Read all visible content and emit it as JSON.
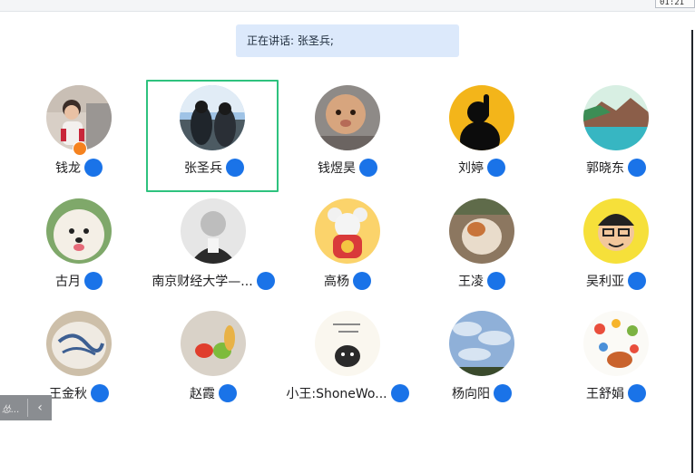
{
  "window": {
    "clock": "01:21"
  },
  "banner": {
    "text": "正在讲话: 张圣兵;"
  },
  "side_panel": {
    "label": "怂...",
    "toggle": "‹"
  },
  "participants": [
    {
      "name": "钱龙",
      "host": true,
      "active": false
    },
    {
      "name": "张圣兵",
      "host": false,
      "active": true
    },
    {
      "name": "钱煜昊",
      "host": false,
      "active": false
    },
    {
      "name": "刘婷",
      "host": false,
      "active": false
    },
    {
      "name": "郭晓东",
      "host": false,
      "active": false
    },
    {
      "name": "古月",
      "host": false,
      "active": false
    },
    {
      "name": "南京财经大学—...",
      "host": false,
      "active": false
    },
    {
      "name": "高杨",
      "host": false,
      "active": false
    },
    {
      "name": "王凌",
      "host": false,
      "active": false
    },
    {
      "name": "吴利亚",
      "host": false,
      "active": false
    },
    {
      "name": "王金秋",
      "host": false,
      "active": false
    },
    {
      "name": "赵霞",
      "host": false,
      "active": false
    },
    {
      "name": "小王:ShoneWo...",
      "host": false,
      "active": false
    },
    {
      "name": "杨向阳",
      "host": false,
      "active": false
    },
    {
      "name": "王舒娟",
      "host": false,
      "active": false
    }
  ],
  "colors": {
    "mic": "#1a73e8",
    "active_border": "#2ec27e",
    "banner_bg": "#dce9fb"
  }
}
